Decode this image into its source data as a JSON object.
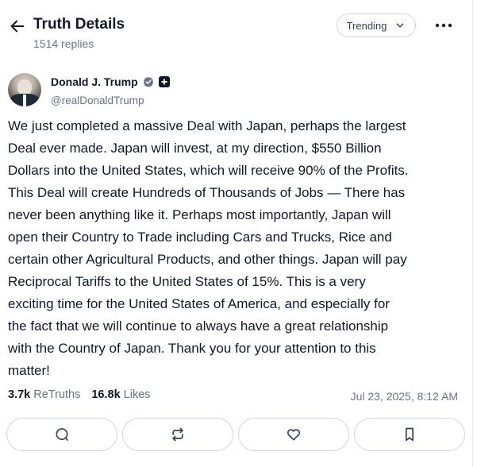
{
  "header": {
    "title": "Truth Details",
    "replies": "1514 replies",
    "sort_label": "Trending"
  },
  "post": {
    "author_name": "Donald J. Trump",
    "handle": "@realDonaldTrump",
    "text": "We just completed a massive Deal with Japan, perhaps the largest\nDeal ever made. Japan will invest, at my direction, $550 Billion\nDollars into the United States, which will receive 90% of the Profits.\nThis Deal will create Hundreds of Thousands of Jobs — There has\nnever been anything like it. Perhaps most importantly, Japan will\nopen their Country to Trade including Cars and Trucks, Rice and\ncertain other Agricultural Products, and other things. Japan will pay\nReciprocal Tariffs to the United States of 15%. This is a very\nexciting time for the United States of America, and especially for\nthe fact that we will continue to always have a great relationship\nwith the Country of Japan. Thank you for your attention to this\nmatter!",
    "retruths_count": "3.7k",
    "retruths_label": "ReTruths",
    "likes_count": "16.8k",
    "likes_label": "Likes",
    "timestamp": "Jul 23, 2025, 8:12 AM"
  },
  "icons": {
    "back": "arrow-left-icon",
    "sort": "chevron-down-icon",
    "more": "more-horizontal-icon",
    "verified": "verified-check-icon",
    "plus": "plus-badge-icon",
    "reply": "comment-icon",
    "retruth": "retruth-icon",
    "like": "heart-icon",
    "bookmark": "bookmark-icon"
  },
  "colors": {
    "text": "#111827",
    "muted": "#6b7280",
    "border": "#d1d5db"
  }
}
